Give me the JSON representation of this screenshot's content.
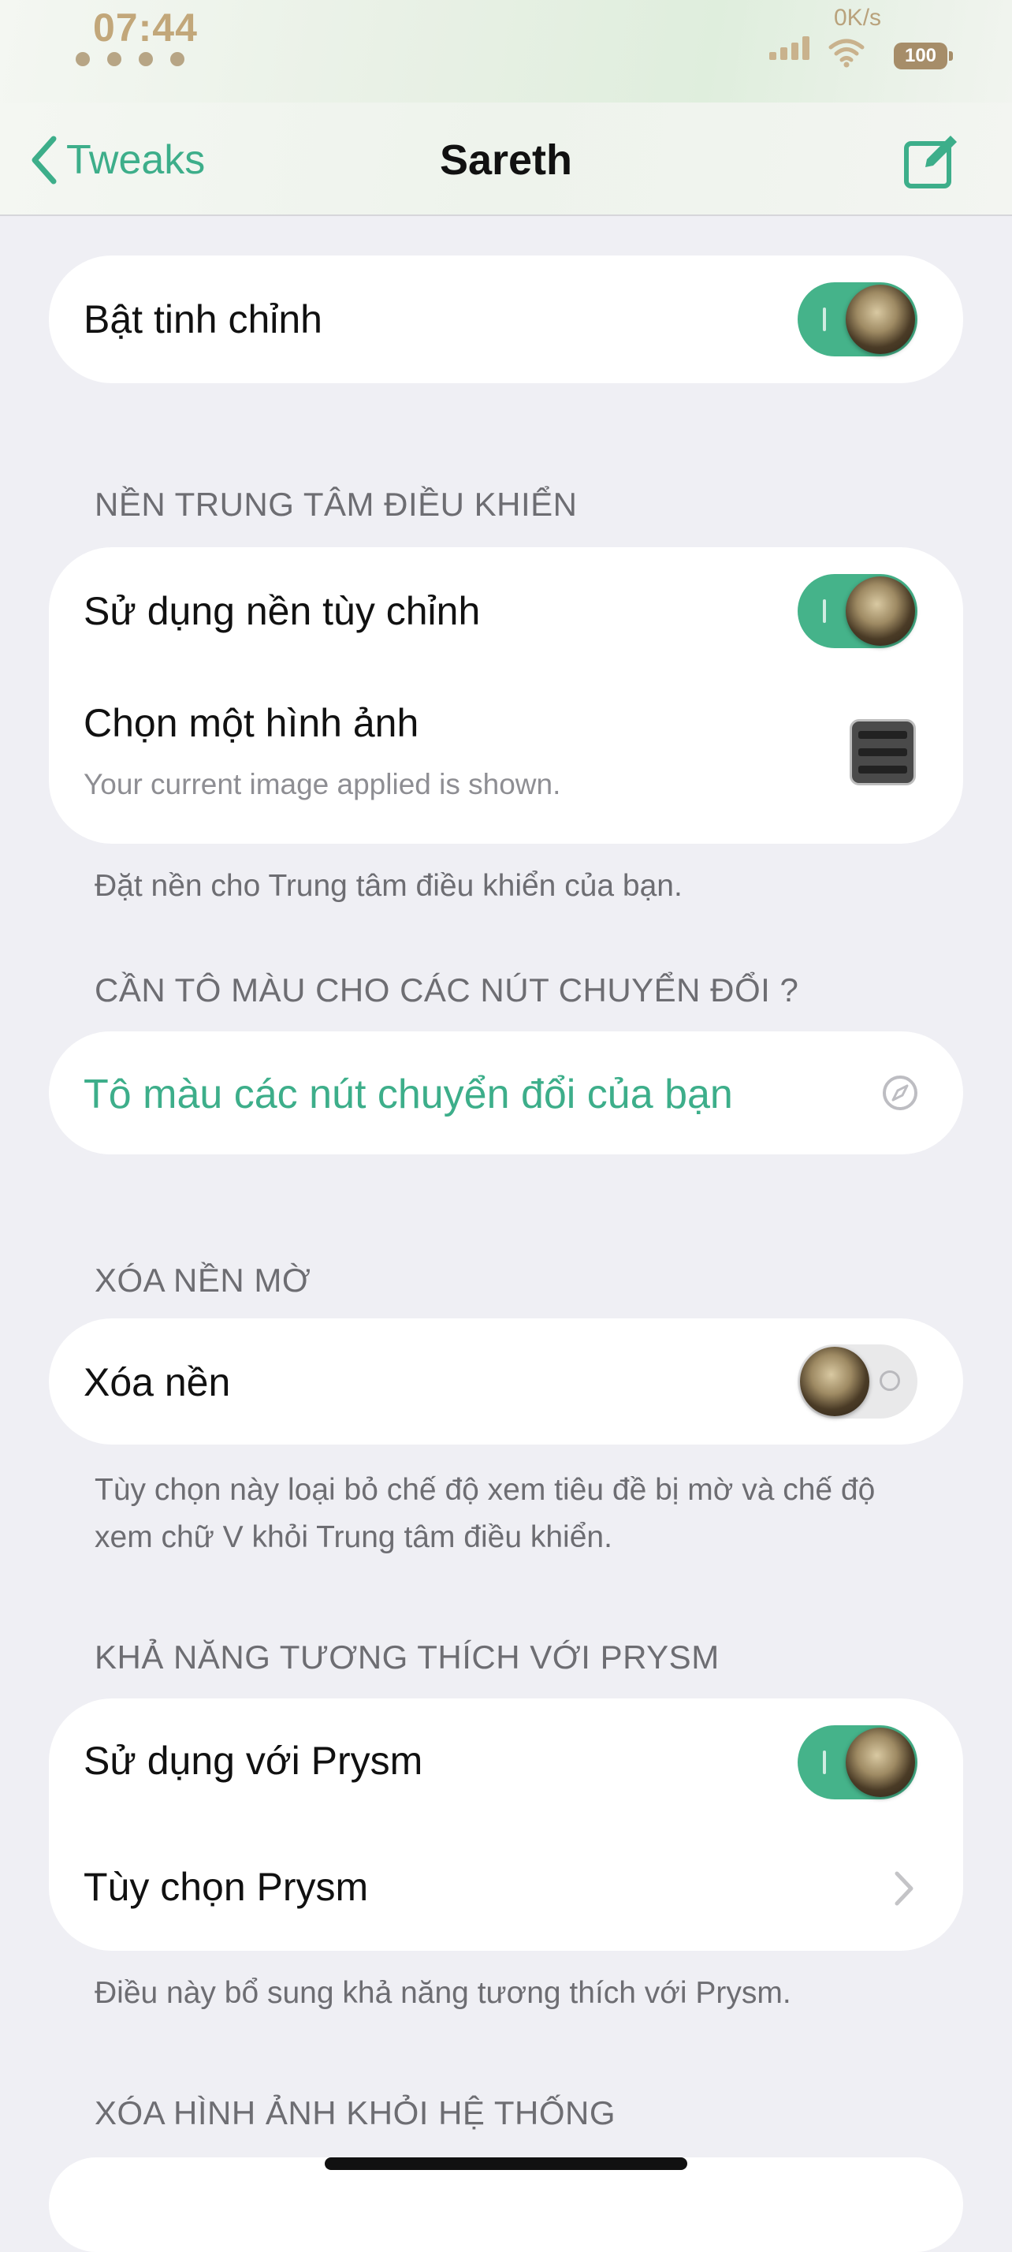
{
  "status_bar": {
    "time": "07:44",
    "net_speed": "0K/s",
    "battery": "100"
  },
  "nav": {
    "back_label": "Tweaks",
    "title": "Sareth"
  },
  "main_toggle": {
    "label": "Bật tinh chỉnh",
    "on": true
  },
  "cc_background": {
    "header": "NỀN TRUNG TÂM ĐIỀU KHIỂN",
    "use_custom_label": "Sử dụng nền tùy chỉnh",
    "use_custom_on": true,
    "choose_image_label": "Chọn một hình ảnh",
    "choose_image_subtitle": "Your current image applied is shown.",
    "footer": "Đặt nền cho Trung tâm điều khiển của bạn."
  },
  "toggle_colors": {
    "header": "CẦN TÔ MÀU CHO CÁC NÚT CHUYỂN ĐỔI ?",
    "link_label": "Tô màu các nút chuyển đổi của bạn"
  },
  "blur": {
    "header": "XÓA NỀN MỜ",
    "remove_label": "Xóa nền",
    "remove_on": false,
    "footer": "Tùy chọn này loại bỏ chế độ xem tiêu đề bị mờ và chế độ xem chữ V khỏi Trung tâm điều khiển."
  },
  "prysm": {
    "header": "KHẢ NĂNG TƯƠNG THÍCH VỚI PRYSM",
    "use_label": "Sử dụng với Prysm",
    "use_on": true,
    "options_label": "Tùy chọn Prysm",
    "footer": "Điều này bổ sung khả năng tương thích với Prysm."
  },
  "system_images": {
    "header": "XÓA HÌNH ẢNH KHỎI HỆ THỐNG"
  },
  "colors": {
    "accent": "#3dae8a",
    "toggle_on": "#45b38a",
    "background": "#efeff4",
    "status_tint": "#c2a77a"
  }
}
